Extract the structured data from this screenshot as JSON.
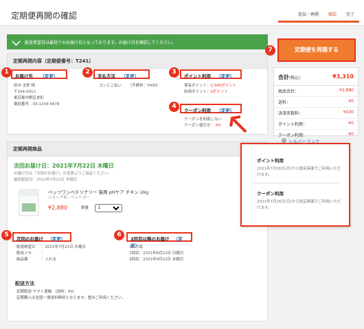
{
  "header": {
    "title": "定期便再開の確認",
    "steps": [
      "追加・再開",
      "確認",
      "完了"
    ]
  },
  "notice": "配送希望日は最短でのお届け日となっております。お届け日を確認してください。",
  "contents": {
    "title": "定期再開内容（定期便番号：T241）",
    "delivery_label": "お届け先",
    "change": "（変更）",
    "address_lines": [
      "田中 太郎 様",
      "〒164-0012",
      "東京都中野区本町",
      "電話番号：03-1234-5678"
    ],
    "payment_label": "支払方法",
    "payment_value": "コンビニ払い",
    "payment_fee": "（手数料：¥430）",
    "points_label": "ポイント利用",
    "points_held": "保有ポイント：",
    "points_held_value": "2,500ポイント",
    "points_used": "利用ポイント：",
    "points_used_value": "0ポイント",
    "coupon_label": "クーポン利用",
    "coupon_none": "クーポンを利用しない",
    "coupon_discount": "クーポン値引き：",
    "coupon_discount_value": "-¥0"
  },
  "products": {
    "title": "定期再開商品",
    "next_delivery": "次回お届け日：2021年7月22日 木曜日",
    "note1": "お届け日は「次回のお届け」の変更よりご指定ください。",
    "note2": "最短配送日：2021年7月22日 木曜日",
    "product_name": "ペッツワンベテリナリー 猫用 pHケア チキン 2kg",
    "shop": "ショップ名：ペットゴー",
    "price": "¥2,880",
    "qty_label": "数量",
    "qty_value": "1",
    "next_label": "次回のお届け",
    "next_rows": [
      [
        "配達希望日",
        "：2021年7月22日 木曜日"
      ],
      [
        "配送メモ",
        "："
      ],
      [
        "納品書",
        "：入れる"
      ]
    ],
    "second_label": "2回目以降のお届け",
    "second_rows": [
      "1ヶ月毎",
      "",
      "2回目：2021年8月22日 日曜日",
      "3回目：2021年9月22日 水曜日"
    ],
    "ship_title": "配送方法",
    "ship_line1": "定期配送  ヤマト運輸  （送料：¥0）",
    "ship_line2": "定期購入は全国一律送料無料となります。重弁ご利用ください。"
  },
  "sidebar": {
    "button": "定期便を再開する",
    "total_label": "合計",
    "total_tax": "(税込)：",
    "total_value": "¥3,310",
    "rows": [
      [
        "商品合計：",
        "¥2,880"
      ],
      [
        "送料：",
        "¥0"
      ],
      [
        "決済手数料：",
        "¥430"
      ],
      [
        "ポイント利用：",
        "-¥0"
      ],
      [
        "クーポン利用：",
        "-¥0"
      ]
    ],
    "rank": "シルバーランク"
  },
  "popup": {
    "points_title": "ポイント利用",
    "points_text": "2021年7月26日(月)から設定画面でご利用いただけます。",
    "coupon_title": "クーポン利用",
    "coupon_text": "2021年7月26日(月)から設定画面でご利用いただけます。"
  },
  "badges": [
    "1",
    "2",
    "3",
    "4",
    "5",
    "6",
    "7"
  ]
}
